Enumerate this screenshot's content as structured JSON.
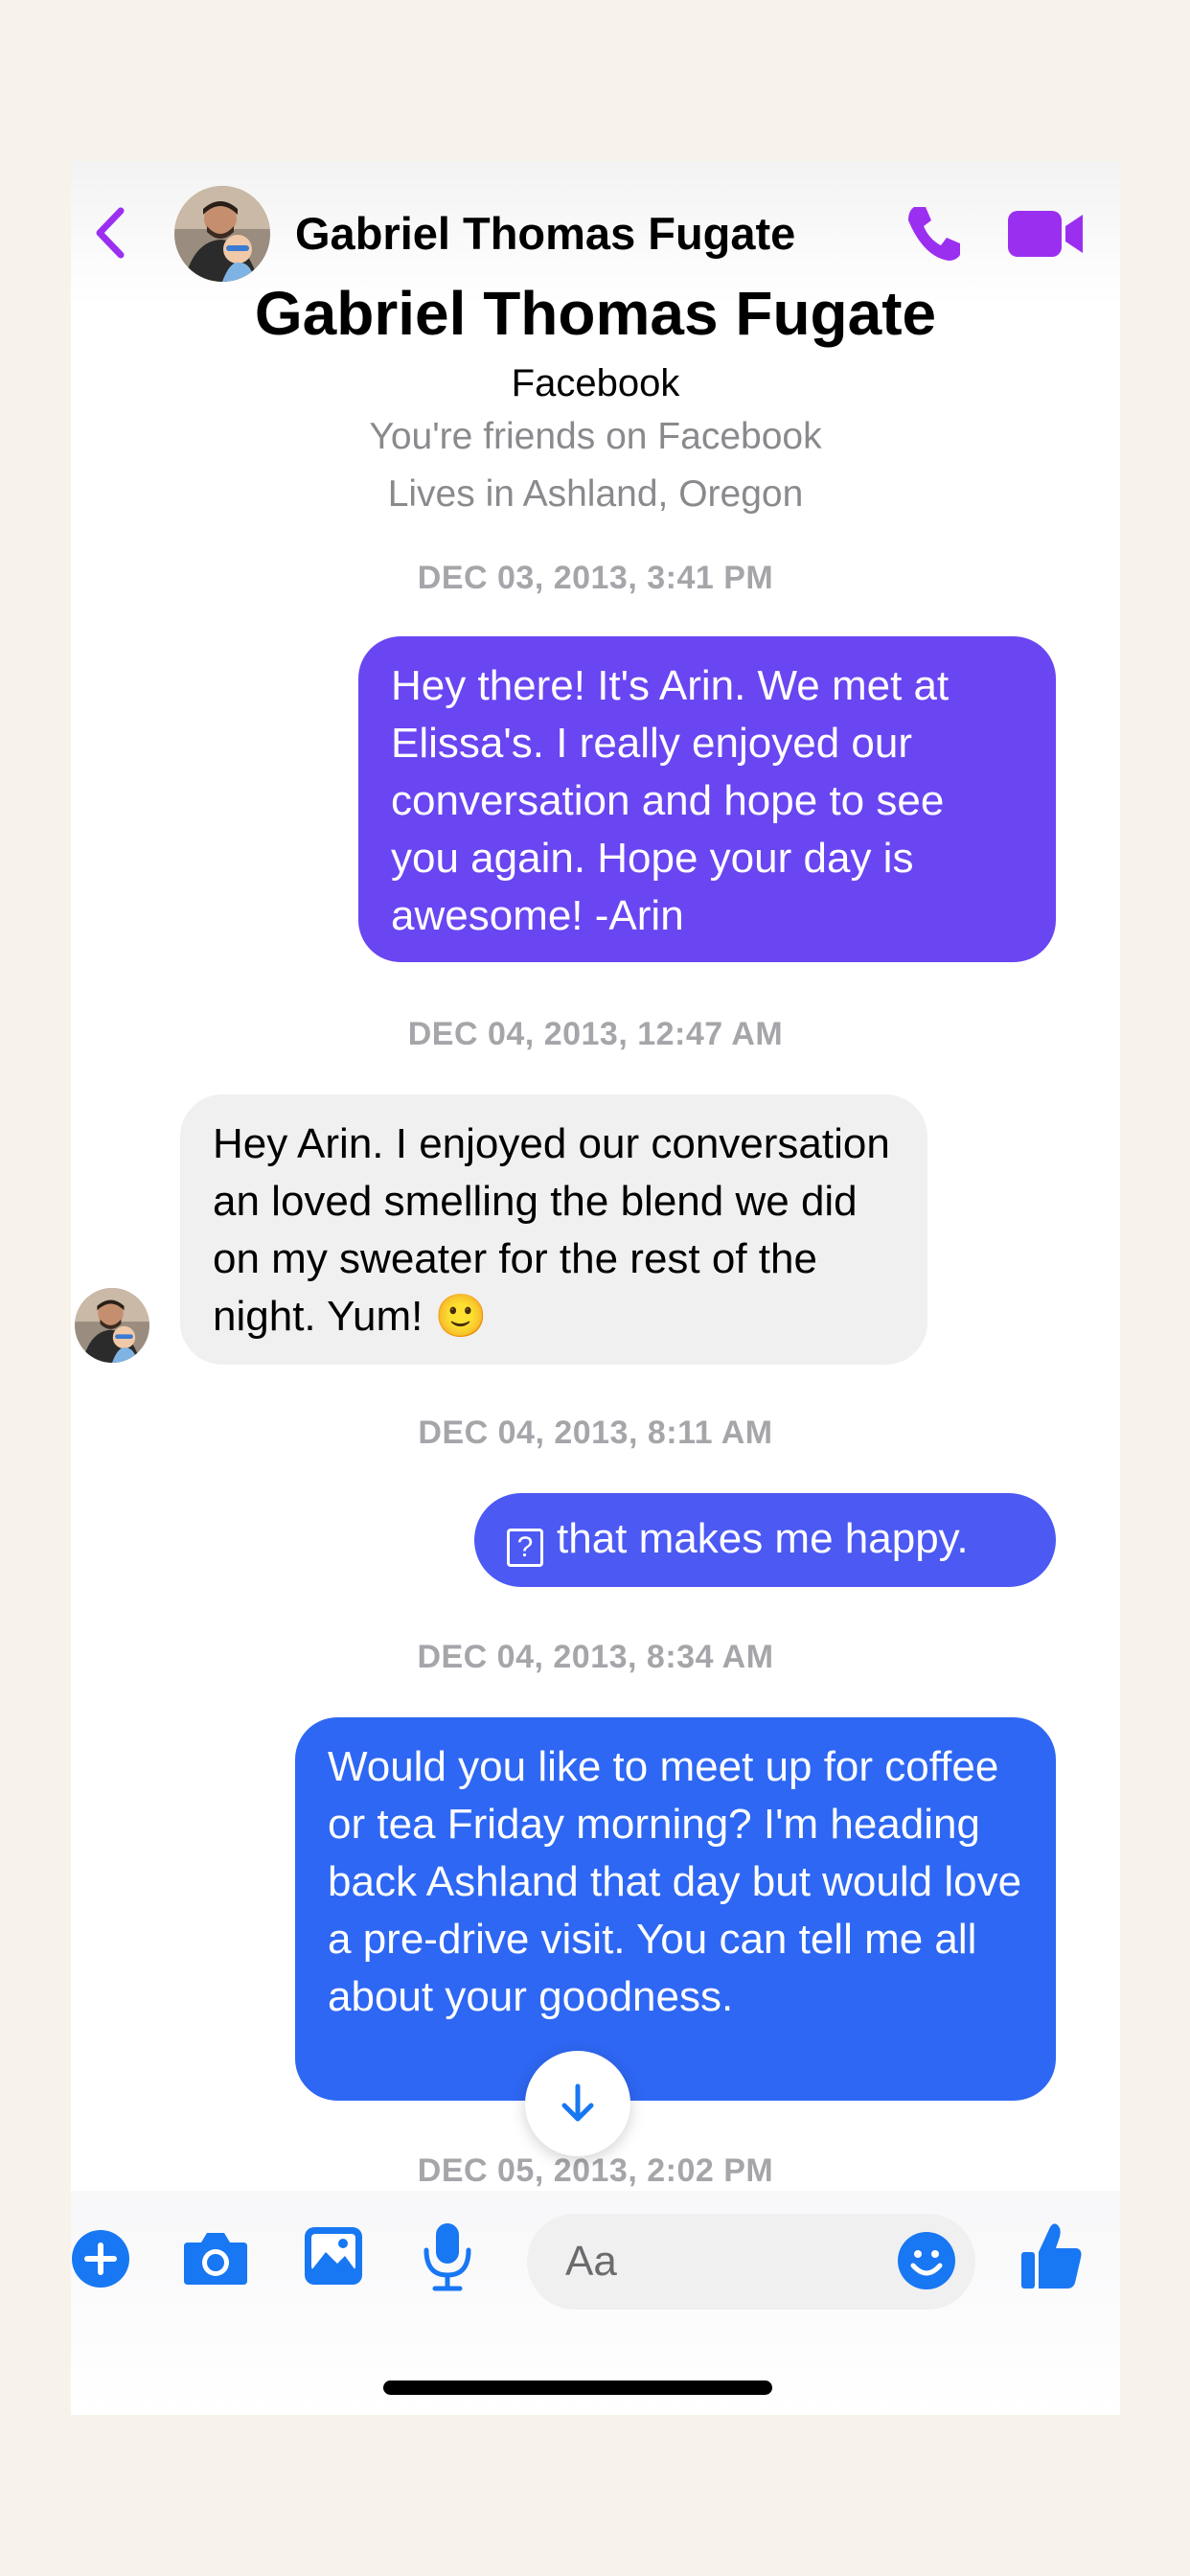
{
  "header": {
    "contact_name": "Gabriel Thomas Fugate"
  },
  "profile": {
    "name": "Gabriel Thomas Fugate",
    "source": "Facebook",
    "friend_status": "You're friends on Facebook",
    "location": "Lives in Ashland, Oregon"
  },
  "messages": [
    {
      "timestamp": "DEC 03, 2013, 3:41 PM",
      "direction": "outgoing",
      "text": "Hey there! It's Arin. We met at Elissa's. I really enjoyed our conversation and hope to see you again. Hope your day is awesome! -Arin"
    },
    {
      "timestamp": "DEC 04, 2013, 12:47 AM",
      "direction": "incoming",
      "text": "Hey Arin. I enjoyed our conversation an loved smelling the blend we did on my sweater for the rest of the night. Yum! 🙂"
    },
    {
      "timestamp": "DEC 04, 2013, 8:11 AM",
      "direction": "outgoing",
      "text": "that makes me happy."
    },
    {
      "timestamp": "DEC 04, 2013, 8:34 AM",
      "direction": "outgoing",
      "text": "Would you like to meet up for coffee or tea Friday morning? I'm heading back Ashland that day but would love a pre-drive visit. You can tell me all about your goodness."
    },
    {
      "timestamp": "DEC 05, 2013, 2:02 PM"
    }
  ],
  "composer": {
    "placeholder": "Aa"
  },
  "icons": {
    "back": "chevron-left-icon",
    "call": "phone-icon",
    "video": "video-camera-icon",
    "add": "plus-icon",
    "camera": "camera-icon",
    "gallery": "image-icon",
    "mic": "microphone-icon",
    "emoji": "smiley-icon",
    "like": "thumbs-up-icon",
    "scroll": "arrow-down-icon",
    "missing_glyph": "?"
  },
  "colors": {
    "header_accent": "#9b2ff0",
    "composer_accent": "#1877f2",
    "bubble_1": "#6a45f2",
    "bubble_2": "#4c59f3",
    "bubble_3": "#2e67f3",
    "incoming_bubble": "#f0f0f0"
  }
}
